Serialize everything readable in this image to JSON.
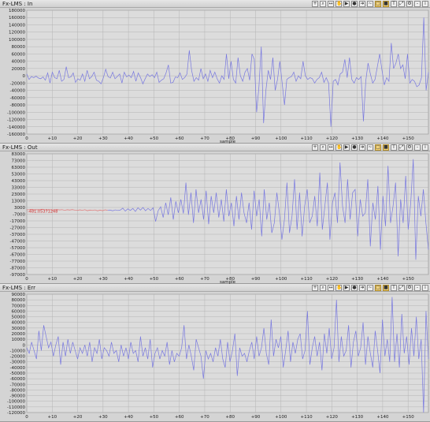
{
  "colors": {
    "series": "#7878e0",
    "tail": "#e07070",
    "grid": "#b4b4b4",
    "plot_bg": "#dcdcdc"
  },
  "toolbar_icons": [
    "zoom-icon",
    "search-icon",
    "pan-icon",
    "hand-icon",
    "play-icon",
    "record-icon",
    "arrow-icon",
    "wave-icon",
    "select-icon",
    "highlight-icon",
    "text-icon",
    "fit-icon",
    "settings-icon",
    "dash-icon",
    "info-icon"
  ],
  "panels": [
    {
      "title": "Fx-LMS : In",
      "xlabel": "sample",
      "xticks": [
        "0",
        "+10",
        "+20",
        "+30",
        "+40",
        "+50",
        "+60",
        "+70",
        "+80",
        "+90",
        "+100",
        "+110",
        "+120",
        "+130",
        "+140",
        "+150"
      ],
      "yticks": [
        "180000",
        "160000",
        "140000",
        "120000",
        "100000",
        "80000",
        "60000",
        "40000",
        "20000",
        "0",
        "-20000",
        "-40000",
        "-60000",
        "-80000",
        "-100000",
        "-120000",
        "-140000",
        "-160000"
      ]
    },
    {
      "title": "Fx-LMS : Out",
      "xlabel": "sample",
      "marker": "-481.05371248",
      "xticks": [
        "0",
        "+10",
        "+20",
        "+30",
        "+40",
        "+50",
        "+60",
        "+70",
        "+80",
        "+90",
        "+100",
        "+110",
        "+120",
        "+130",
        "+140",
        "+150"
      ],
      "yticks": [
        "83000",
        "73000",
        "63000",
        "53000",
        "43000",
        "33000",
        "23000",
        "13000",
        "3000",
        "-7000",
        "-17000",
        "-27000",
        "-37000",
        "-47000",
        "-57000",
        "-67000",
        "-77000",
        "-87000",
        "-97000"
      ]
    },
    {
      "title": "Fx-LMS : Err",
      "xlabel": "",
      "xticks": [
        "0",
        "+10",
        "+20",
        "+30",
        "+40",
        "+50",
        "+60",
        "+70",
        "+80",
        "+90",
        "+100",
        "+110",
        "+120",
        "+130",
        "+140",
        "+150"
      ],
      "yticks": [
        "90000",
        "80000",
        "70000",
        "60000",
        "50000",
        "40000",
        "30000",
        "20000",
        "10000",
        "0",
        "-10000",
        "-20000",
        "-30000",
        "-40000",
        "-50000",
        "-60000",
        "-70000",
        "-80000",
        "-90000",
        "-100000",
        "-110000",
        "-120000"
      ]
    }
  ],
  "chart_data": [
    {
      "type": "line",
      "title": "Fx-LMS : In",
      "xlabel": "sample",
      "ylim": [
        -160000,
        180000
      ],
      "xlim": [
        0,
        158
      ],
      "series": [
        {
          "values": [
            5000,
            -10000,
            -2000,
            -5000,
            -1000,
            -6000,
            -8000,
            -3000,
            -12000,
            8000,
            -20000,
            10000,
            -5000,
            -8000,
            15000,
            -15000,
            -10000,
            25000,
            -5000,
            -3000,
            8000,
            -18000,
            -8000,
            -12000,
            5000,
            -15000,
            15000,
            -8000,
            -2000,
            10000,
            -12000,
            -15000,
            -22000,
            -5000,
            18000,
            -2000,
            -6000,
            10000,
            -8000,
            -2000,
            5000,
            -20000,
            10000,
            -3000,
            2000,
            -5000,
            12000,
            -15000,
            8000,
            -5000,
            -22000,
            -8000,
            5000,
            -2000,
            3000,
            -5000,
            10000,
            -18000,
            -12000,
            -8000,
            8000,
            30000,
            -20000,
            -18000,
            -3000,
            -5000,
            8000,
            -10000,
            -5000,
            5000,
            70000,
            15000,
            -15000,
            -5000,
            -12000,
            20000,
            -8000,
            5000,
            -15000,
            15000,
            -5000,
            10000,
            -8000,
            -20000,
            0,
            -10000,
            60000,
            -8000,
            40000,
            -10000,
            -20000,
            50000,
            0,
            -15000,
            10000,
            20000,
            -12000,
            60000,
            45000,
            -100000,
            -30000,
            80000,
            -130000,
            -40000,
            15000,
            -10000,
            50000,
            -40000,
            -10000,
            40000,
            -20000,
            -80000,
            -10000,
            -5000,
            -2000,
            10000,
            -15000,
            0,
            -8000,
            40000,
            0,
            -10000,
            -5000,
            -8000,
            -20000,
            -10000,
            -5000,
            10000,
            -18000,
            -5000,
            -20000,
            -140000,
            -15000,
            -10000,
            -25000,
            5000,
            10000,
            45000,
            -5000,
            50000,
            -10000,
            -20000,
            -5000,
            -10000,
            -2000,
            -125000,
            -15000,
            35000,
            5000,
            -20000,
            -10000,
            25000,
            60000,
            15000,
            -25000,
            -5000,
            -15000,
            90000,
            20000,
            35000,
            60000,
            20000,
            30000,
            -8000,
            60000,
            -20000,
            -10000,
            -15000,
            -30000,
            -25000,
            -5000,
            160000,
            -40000,
            10000
          ]
        }
      ]
    },
    {
      "type": "line",
      "title": "Fx-LMS : Out",
      "xlabel": "sample",
      "ylim": [
        -97000,
        83000
      ],
      "xlim": [
        0,
        158
      ],
      "series": [
        {
          "values": [
            -500,
            -300,
            200,
            -800,
            -200,
            -600,
            300,
            -500,
            -800,
            -300,
            -1000,
            -500,
            -200,
            -700,
            -300,
            -1200,
            -400,
            -800,
            -200,
            -900,
            -1500,
            -500,
            -1200,
            -300,
            -1800,
            -800,
            -1500,
            -600,
            -2000,
            -1000,
            -1800,
            -500,
            -1200,
            -800,
            -2000,
            -600,
            -1500,
            -1000,
            2000,
            -2500,
            1000,
            -1500,
            1500,
            -3000,
            2500,
            -1000,
            3000,
            -2000,
            1500,
            -1500,
            2500,
            -18000,
            -2000,
            4000,
            -12000,
            10000,
            -8000,
            18000,
            -15000,
            12000,
            -5000,
            15000,
            -6000,
            40000,
            -8000,
            25000,
            -20000,
            30000,
            -5000,
            15000,
            -15000,
            28000,
            -22000,
            20000,
            -5000,
            25000,
            -12000,
            15000,
            -18000,
            30000,
            -10000,
            10000,
            -25000,
            20000,
            -15000,
            25000,
            -5000,
            -20000,
            10000,
            -30000,
            28000,
            -10000,
            15000,
            -40000,
            30000,
            -15000,
            10000,
            -35000,
            -20000,
            25000,
            -5000,
            -45000,
            -15000,
            40000,
            -35000,
            -10000,
            45000,
            -30000,
            25000,
            -40000,
            5000,
            30000,
            -20000,
            -10000,
            20000,
            -25000,
            55000,
            -30000,
            5000,
            40000,
            -45000,
            10000,
            25000,
            -20000,
            70000,
            5000,
            -20000,
            45000,
            -15000,
            25000,
            30000,
            -40000,
            15000,
            -10000,
            -5000,
            45000,
            -55000,
            10000,
            -15000,
            35000,
            -60000,
            20000,
            -25000,
            65000,
            -20000,
            5000,
            40000,
            -70000,
            15000,
            -20000,
            50000,
            -30000,
            10000,
            75000,
            -75000,
            20000,
            -10000,
            30000,
            -20000,
            -60000
          ]
        }
      ]
    },
    {
      "type": "line",
      "title": "Fx-LMS : Err",
      "xlabel": "",
      "ylim": [
        -120000,
        90000
      ],
      "xlim": [
        0,
        158
      ],
      "series": [
        {
          "values": [
            -5000,
            -15000,
            5000,
            -10000,
            -25000,
            25000,
            -10000,
            35000,
            15000,
            -5000,
            5000,
            -20000,
            0,
            15000,
            -35000,
            5000,
            -20000,
            10000,
            -15000,
            5000,
            -10000,
            -25000,
            -5000,
            -15000,
            0,
            -20000,
            5000,
            -30000,
            -5000,
            -15000,
            10000,
            -25000,
            -5000,
            -10000,
            -20000,
            5000,
            -15000,
            -10000,
            -30000,
            0,
            -20000,
            -5000,
            -25000,
            5000,
            -15000,
            -10000,
            -30000,
            15000,
            -20000,
            -5000,
            -25000,
            10000,
            -40000,
            -15000,
            -5000,
            -25000,
            -10000,
            -20000,
            5000,
            -35000,
            -10000,
            -30000,
            -15000,
            -20000,
            -5000,
            35000,
            -25000,
            0,
            -20000,
            -45000,
            10000,
            -5000,
            -20000,
            -60000,
            -10000,
            -25000,
            -15000,
            -30000,
            -5000,
            -20000,
            10000,
            -25000,
            -40000,
            5000,
            -30000,
            -10000,
            20000,
            -55000,
            -5000,
            -20000,
            -15000,
            -30000,
            -10000,
            5000,
            -25000,
            15000,
            -20000,
            -5000,
            30000,
            -15000,
            -35000,
            45000,
            -20000,
            10000,
            -5000,
            15000,
            -40000,
            -10000,
            25000,
            -30000,
            5000,
            -15000,
            10000,
            20000,
            -25000,
            -10000,
            60000,
            -35000,
            -5000,
            15000,
            -20000,
            5000,
            -45000,
            20000,
            -15000,
            30000,
            -25000,
            -5000,
            80000,
            -30000,
            15000,
            -20000,
            -10000,
            35000,
            -40000,
            5000,
            25000,
            -20000,
            -5000,
            40000,
            -35000,
            15000,
            -15000,
            -40000,
            25000,
            -10000,
            -50000,
            45000,
            -20000,
            10000,
            -30000,
            85000,
            -30000,
            20000,
            -40000,
            55000,
            -15000,
            15000,
            -35000,
            30000,
            -20000,
            50000,
            -25000,
            10000,
            -120000,
            60000,
            -25000
          ]
        }
      ]
    }
  ]
}
